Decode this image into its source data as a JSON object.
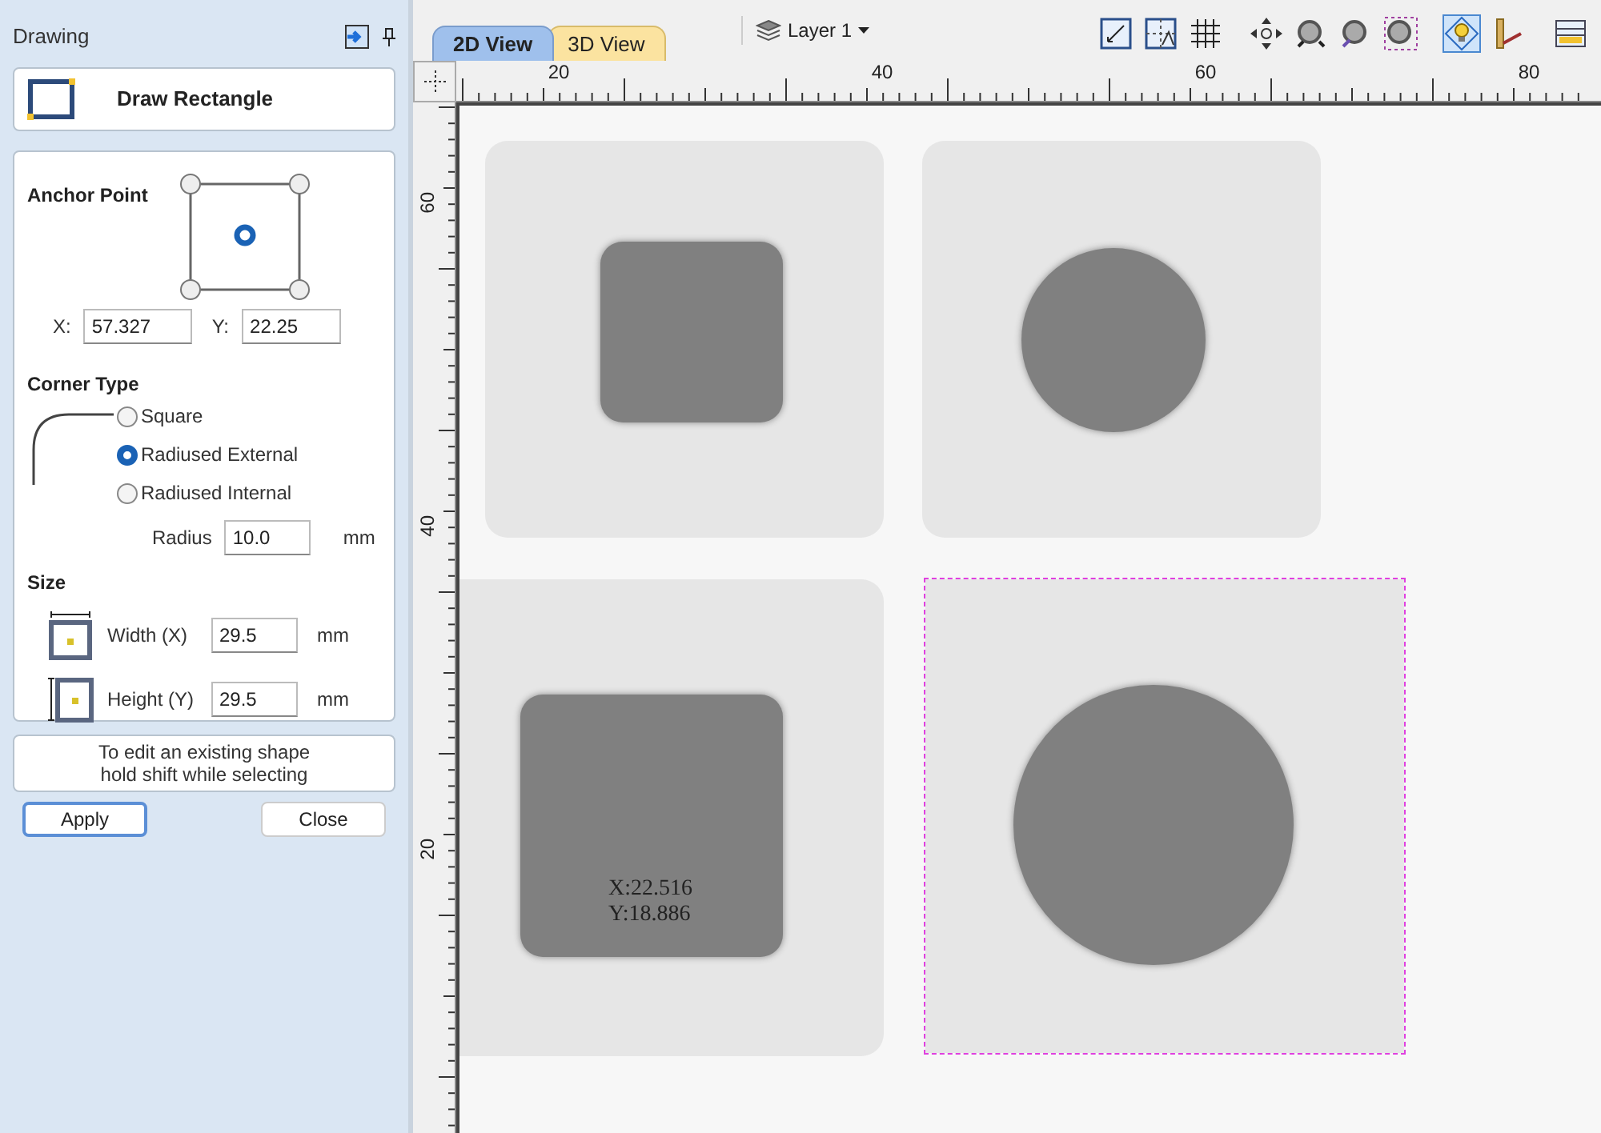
{
  "panel": {
    "title": "Drawing",
    "tool_title": "Draw Rectangle"
  },
  "anchor": {
    "label": "Anchor Point",
    "points": [
      {
        "selected": false
      },
      {
        "selected": false
      },
      {
        "selected": true
      },
      {
        "selected": false
      },
      {
        "selected": false
      }
    ],
    "x_label": "X:",
    "x_value": "57.327",
    "y_label": "Y:",
    "y_value": "22.25"
  },
  "corner_type": {
    "label": "Corner Type",
    "options": [
      {
        "label": "Square",
        "selected": false
      },
      {
        "label": "Radiused External",
        "selected": true
      },
      {
        "label": "Radiused Internal",
        "selected": false
      }
    ],
    "radius_label": "Radius",
    "radius_value": "10.0",
    "radius_unit": "mm"
  },
  "size": {
    "label": "Size",
    "fields": [
      {
        "kind": "width",
        "label": "Width (X)",
        "value": "29.5",
        "unit": "mm"
      },
      {
        "kind": "height",
        "label": "Height (Y)",
        "value": "29.5",
        "unit": "mm"
      }
    ]
  },
  "hint": [
    "To edit an existing shape",
    "hold shift while selecting"
  ],
  "buttons": [
    {
      "label": "Apply",
      "default": true
    },
    {
      "label": "Close",
      "default": false
    }
  ],
  "tabs": [
    {
      "label": "2D View",
      "selected": true
    },
    {
      "label": "3D View",
      "selected": false
    }
  ],
  "layer": {
    "label": "Layer 1"
  },
  "rulers": {
    "horizontal": [
      "20",
      "40",
      "60",
      "80"
    ],
    "vertical": [
      "60",
      "40",
      "20"
    ]
  },
  "shapes": [
    {
      "kind": "rounded-square",
      "selected": false
    },
    {
      "kind": "circle",
      "selected": false
    },
    {
      "kind": "rounded-square",
      "selected": false
    },
    {
      "kind": "circle",
      "selected": true
    }
  ],
  "cursor_readout": [
    "X:22.516",
    "Y:18.886"
  ]
}
